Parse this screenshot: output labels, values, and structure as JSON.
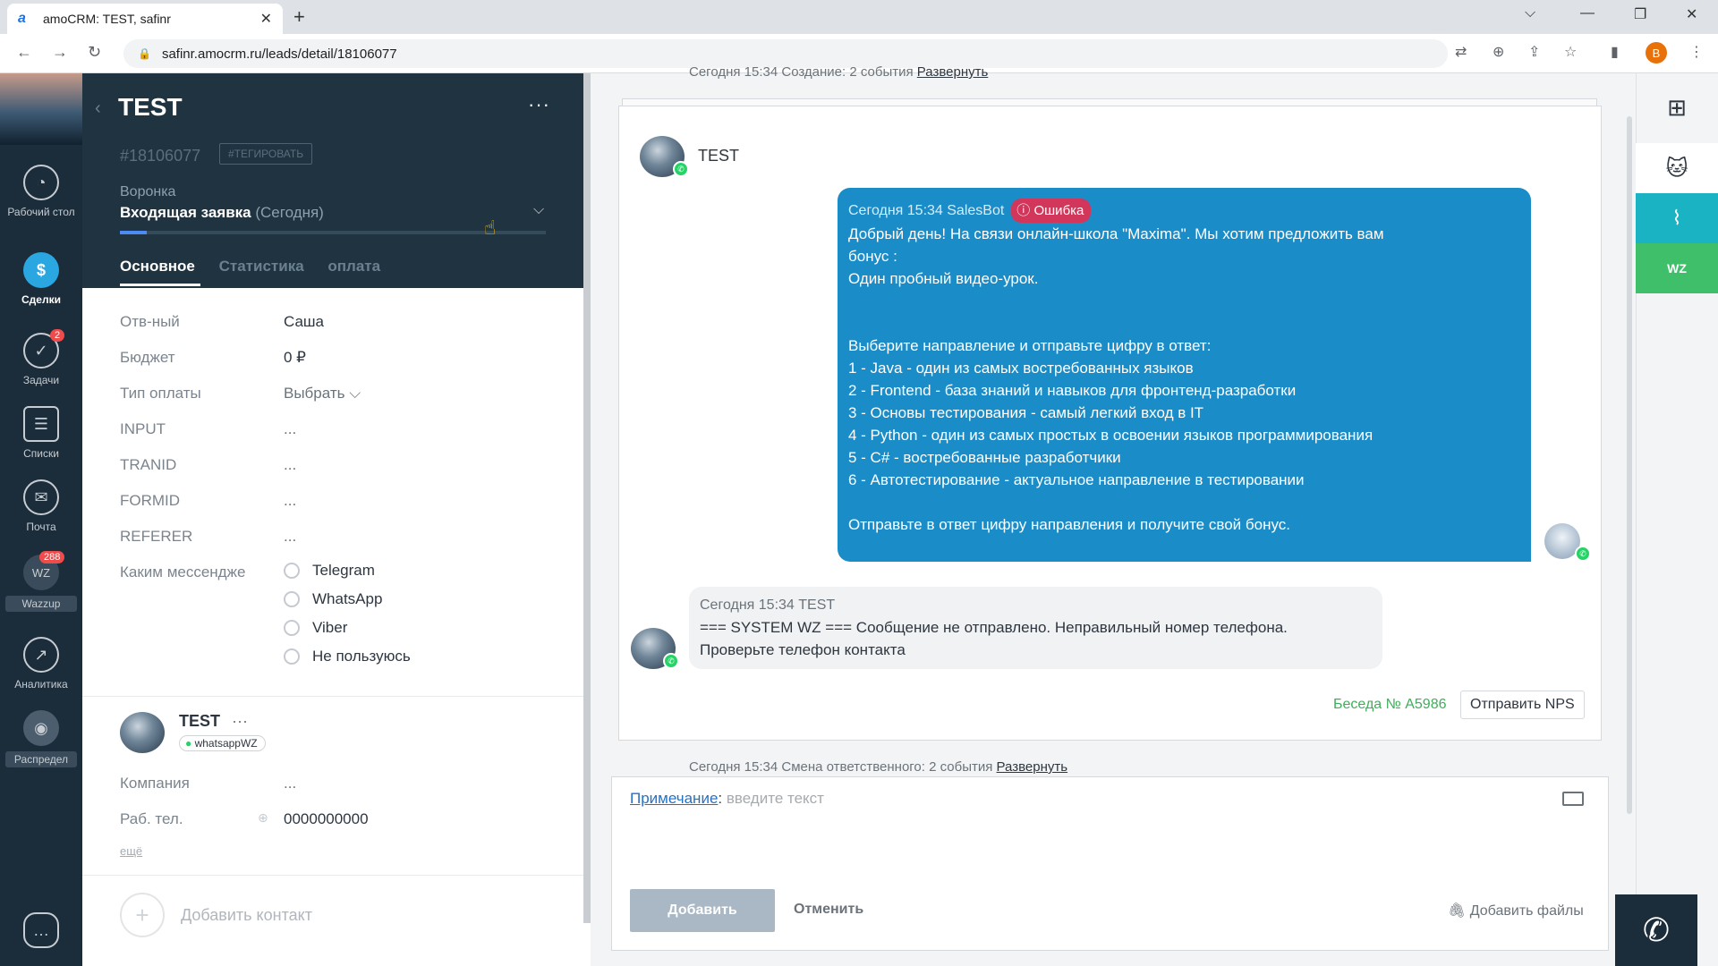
{
  "browser": {
    "tab_title": "amoCRM: TEST, safinr",
    "favicon": "a",
    "url": "safinr.amocrm.ru/leads/detail/18106077",
    "profile_letter": "B"
  },
  "nav": {
    "items": [
      {
        "label": "Рабочий стол",
        "icon": "dashboard-icon"
      },
      {
        "label": "Сделки",
        "icon": "deals-icon"
      },
      {
        "label": "Задачи",
        "icon": "tasks-icon",
        "badge": "2"
      },
      {
        "label": "Списки",
        "icon": "lists-icon"
      },
      {
        "label": "Почта",
        "icon": "mail-icon"
      },
      {
        "label": "Wazzup",
        "icon": "wazzup-icon",
        "badge": "288",
        "short": "WZ"
      },
      {
        "label": "Аналитика",
        "icon": "analytics-icon"
      },
      {
        "label": "Распредел",
        "icon": "distribution-icon"
      }
    ]
  },
  "lead": {
    "title": "TEST",
    "id": "#18106077",
    "tag_button": "#ТЕГИРОВАТЬ",
    "funnel_label": "Воронка",
    "stage": "Входящая заявка",
    "stage_date": "(Сегодня)",
    "tabs": [
      "Основное",
      "Статистика",
      "оплата"
    ]
  },
  "fields": [
    {
      "label": "Отв-ный",
      "value": "Саша"
    },
    {
      "label": "Бюджет",
      "value": "0 ₽"
    },
    {
      "label": "Тип оплаты",
      "value": "Выбрать ⌵"
    },
    {
      "label": "INPUT",
      "value": "..."
    },
    {
      "label": "TRANID",
      "value": "..."
    },
    {
      "label": "FORMID",
      "value": "..."
    },
    {
      "label": "REFERER",
      "value": "..."
    }
  ],
  "messenger": {
    "label": "Каким мессендже",
    "options": [
      "Telegram",
      "WhatsApp",
      "Viber",
      "Не пользуюсь"
    ]
  },
  "contact": {
    "name": "TEST",
    "dots": "···",
    "tag": "whatsappWZ",
    "company_label": "Компания",
    "company_value": "...",
    "phone_label": "Раб. тел.",
    "phone_value": "0000000000",
    "more": "ещё",
    "add_contact": "Добавить контакт"
  },
  "feed": {
    "top_event": "Сегодня 15:34 Создание: 2 события",
    "expand": "Развернуть",
    "chat_name": "TEST",
    "out_meta": "Сегодня 15:34 SalesBot",
    "error": "Ошибка",
    "out_lines": [
      "Добрый день! На связи онлайн-школа \"Maxima\". Мы хотим предложить вам",
      "бонус :",
      "Один пробный видео-урок.",
      "",
      "",
      "Выберите направление и отправьте цифру в ответ:",
      "1 - Java - один из самых востребованных языков",
      "2 - Frontend - база знаний и навыков для фронтенд-разработки",
      "3 - Основы тестирования - самый легкий вход в IT",
      "4 - Python - один из самых простых в освоении языков программирования",
      "5 - C# - востребованные разработчики",
      "6 - Автотестирование - актуальное направление в тестировании",
      "",
      "Отправьте в ответ цифру направления и получите свой бонус."
    ],
    "in_meta": "Сегодня 15:34 TEST",
    "in_lines": [
      "=== SYSTEM WZ === Сообщение не отправлено. Неправильный номер телефона.",
      "Проверьте телефон контакта"
    ],
    "conversation": "Беседа № A5986",
    "nps_button": "Отправить NPS",
    "bottom_event": "Сегодня 15:34 Смена ответственного: 2 события",
    "note_label": "Примечание",
    "note_placeholder": "введите текст",
    "add_button": "Добавить",
    "cancel_button": "Отменить",
    "add_files": "Добавить файлы"
  },
  "right": {
    "wz": "WZ"
  }
}
